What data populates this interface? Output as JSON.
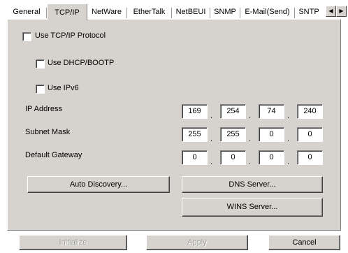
{
  "tabs": [
    {
      "label": "General",
      "active": false
    },
    {
      "label": "TCP/IP",
      "active": true
    },
    {
      "label": "NetWare",
      "active": false
    },
    {
      "label": "EtherTalk",
      "active": false
    },
    {
      "label": "NetBEUI",
      "active": false
    },
    {
      "label": "SNMP",
      "active": false
    },
    {
      "label": "E-Mail(Send)",
      "active": false
    },
    {
      "label": "SNTP",
      "active": false
    }
  ],
  "tab_scroll": {
    "left_icon": "arrow-left-icon",
    "right_icon": "arrow-right-icon",
    "left_glyph": "◀",
    "right_glyph": "▶"
  },
  "tcpip": {
    "use_tcpip_label": "Use TCP/IP Protocol",
    "use_tcpip_checked": false,
    "use_dhcp_label": "Use DHCP/BOOTP",
    "use_dhcp_checked": false,
    "use_ipv6_label": "Use IPv6",
    "use_ipv6_checked": false,
    "ip_address_label": "IP Address",
    "ip_address": [
      "169",
      "254",
      "74",
      "240"
    ],
    "subnet_mask_label": "Subnet Mask",
    "subnet_mask": [
      "255",
      "255",
      "0",
      "0"
    ],
    "default_gateway_label": "Default Gateway",
    "default_gateway": [
      "0",
      "0",
      "0",
      "0"
    ],
    "octet_separator": "."
  },
  "buttons": {
    "auto_discovery": "Auto Discovery...",
    "dns_server": "DNS Server...",
    "wins_server": "WINS Server...",
    "initialize": "Initialize",
    "apply": "Apply",
    "cancel": "Cancel"
  },
  "colors": {
    "face": "#d6d3ce",
    "disabled_text": "#a0a0a0"
  }
}
